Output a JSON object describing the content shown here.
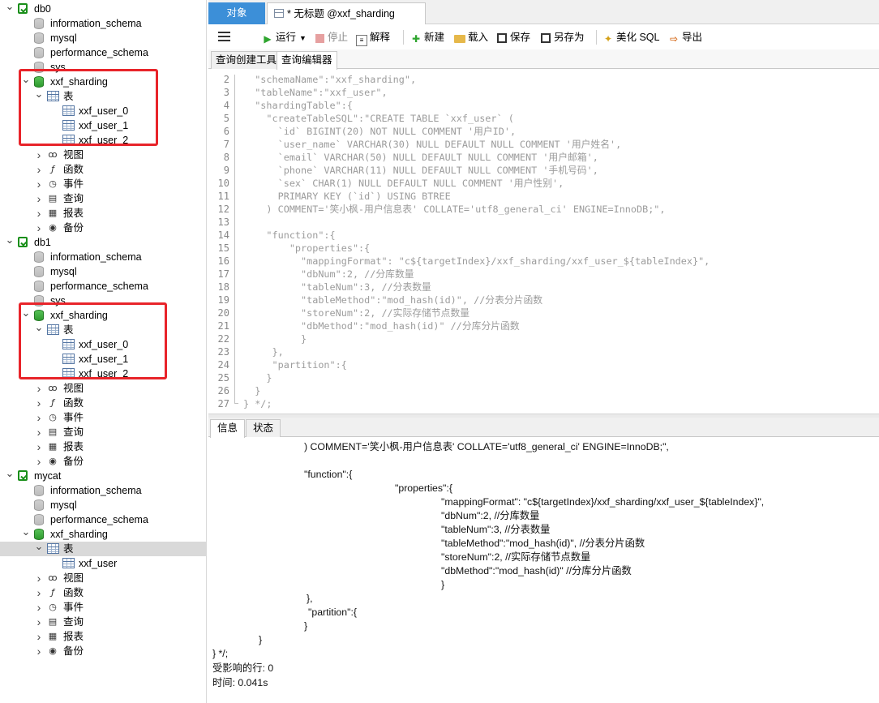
{
  "tree": {
    "connections": [
      {
        "name": "db0",
        "databases": [
          "information_schema",
          "mysql",
          "performance_schema",
          "sys"
        ],
        "open_db": {
          "name": "xxf_sharding",
          "tables_label": "表",
          "tables": [
            "xxf_user_0",
            "xxf_user_1",
            "xxf_user_2"
          ],
          "groups": [
            "视图",
            "函数",
            "事件",
            "查询",
            "报表",
            "备份"
          ]
        }
      },
      {
        "name": "db1",
        "databases": [
          "information_schema",
          "mysql",
          "performance_schema",
          "sys"
        ],
        "open_db": {
          "name": "xxf_sharding",
          "tables_label": "表",
          "tables": [
            "xxf_user_0",
            "xxf_user_1",
            "xxf_user_2"
          ],
          "groups": [
            "视图",
            "函数",
            "事件",
            "查询",
            "报表",
            "备份"
          ]
        }
      },
      {
        "name": "mycat",
        "databases": [
          "information_schema",
          "mysql",
          "performance_schema"
        ],
        "open_db": {
          "name": "xxf_sharding",
          "tables_label": "表",
          "tables": [
            "xxf_user"
          ],
          "groups": [
            "视图",
            "函数",
            "事件",
            "查询",
            "报表",
            "备份"
          ]
        }
      }
    ],
    "group_icons": [
      "glasses-icon",
      "function-icon",
      "clock-icon",
      "query-icon",
      "report-icon",
      "backup-icon"
    ]
  },
  "tabs": {
    "objects": "对象",
    "query": "* 无标题 @xxf_sharding (my..."
  },
  "toolbar": {
    "run": "运行",
    "stop": "停止",
    "explain": "解释",
    "new": "新建",
    "load": "载入",
    "save": "保存",
    "save_as": "另存为",
    "beautify": "美化 SQL",
    "export": "导出"
  },
  "subtabs": [
    "查询创建工具",
    "查询编辑器"
  ],
  "editor": {
    "lines": [
      {
        "n": "2",
        "t": "  \"schemaName\":\"xxf_sharding\","
      },
      {
        "n": "3",
        "t": "  \"tableName\":\"xxf_user\","
      },
      {
        "n": "4",
        "t": "  \"shardingTable\":{"
      },
      {
        "n": "5",
        "t": "    \"createTableSQL\":\"CREATE TABLE `xxf_user` ("
      },
      {
        "n": "6",
        "t": "      `id` BIGINT(20) NOT NULL COMMENT '用户ID',"
      },
      {
        "n": "7",
        "t": "      `user_name` VARCHAR(30) NULL DEFAULT NULL COMMENT '用户姓名',"
      },
      {
        "n": "8",
        "t": "      `email` VARCHAR(50) NULL DEFAULT NULL COMMENT '用户邮箱',"
      },
      {
        "n": "9",
        "t": "      `phone` VARCHAR(11) NULL DEFAULT NULL COMMENT '手机号码',"
      },
      {
        "n": "10",
        "t": "      `sex` CHAR(1) NULL DEFAULT NULL COMMENT '用户性别',"
      },
      {
        "n": "11",
        "t": "      PRIMARY KEY (`id`) USING BTREE"
      },
      {
        "n": "12",
        "t": "    ) COMMENT='笑小枫-用户信息表' COLLATE='utf8_general_ci' ENGINE=InnoDB;\","
      },
      {
        "n": "13",
        "t": ""
      },
      {
        "n": "14",
        "t": "    \"function\":{"
      },
      {
        "n": "15",
        "t": "        \"properties\":{"
      },
      {
        "n": "16",
        "t": "          \"mappingFormat\": \"c${targetIndex}/xxf_sharding/xxf_user_${tableIndex}\","
      },
      {
        "n": "17",
        "t": "          \"dbNum\":2, //分库数量"
      },
      {
        "n": "18",
        "t": "          \"tableNum\":3, //分表数量"
      },
      {
        "n": "19",
        "t": "          \"tableMethod\":\"mod_hash(id)\", //分表分片函数"
      },
      {
        "n": "20",
        "t": "          \"storeNum\":2, //实际存储节点数量"
      },
      {
        "n": "21",
        "t": "          \"dbMethod\":\"mod_hash(id)\" //分库分片函数"
      },
      {
        "n": "22",
        "t": "          }"
      },
      {
        "n": "23",
        "t": "     },"
      },
      {
        "n": "24",
        "t": "     \"partition\":{"
      },
      {
        "n": "25",
        "t": "    }"
      },
      {
        "n": "26",
        "t": "  }"
      },
      {
        "n": "27",
        "t": "} */;"
      }
    ]
  },
  "bottom_tabs": [
    "信息",
    "状态"
  ],
  "info": {
    "lines": [
      ") COMMENT='笑小枫-用户信息表' COLLATE='utf8_general_ci' ENGINE=InnoDB;\",",
      "\"function\":{",
      "\"properties\":{",
      "\"mappingFormat\": \"c${targetIndex}/xxf_sharding/xxf_user_${tableIndex}\",",
      "\"dbNum\":2, //分库数量",
      "\"tableNum\":3, //分表数量",
      "\"tableMethod\":\"mod_hash(id)\", //分表分片函数",
      "\"storeNum\":2, //实际存储节点数量",
      "\"dbMethod\":\"mod_hash(id)\" //分库分片函数",
      "}",
      "},",
      "\"partition\":{",
      "}",
      "}",
      "} */;",
      "受影响的行: 0",
      "时间: 0.041s"
    ]
  },
  "colors": {
    "active_tab": "#3c8fd8",
    "highlight_box": "#e8242a",
    "connection_icon": "#1a8f1a",
    "selected_row": "#d9d9d9"
  }
}
